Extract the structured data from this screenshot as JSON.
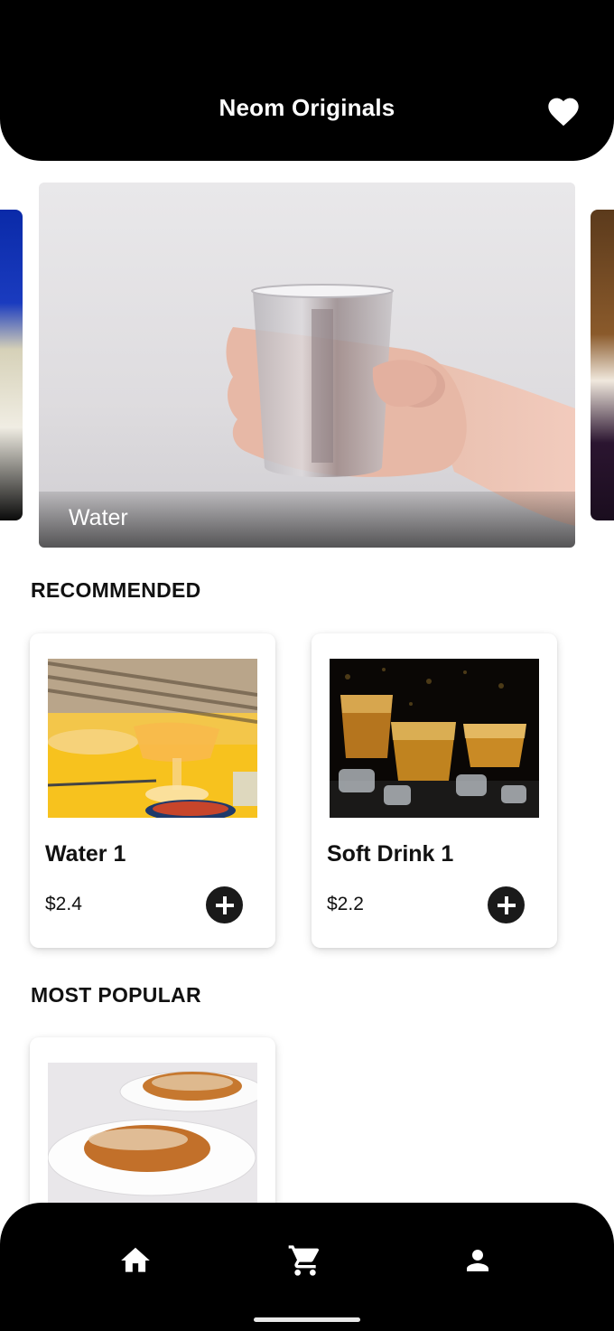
{
  "header": {
    "title": "Neom Originals",
    "favorite_icon": "heart-icon"
  },
  "carousel": {
    "active_slide": {
      "caption": "Water"
    }
  },
  "sections": {
    "recommended_title": "RECOMMENDED",
    "most_popular_title": "MOST POPULAR"
  },
  "recommended": [
    {
      "name": "Water 1",
      "price": "$2.4"
    },
    {
      "name": "Soft Drink 1",
      "price": "$2.2"
    }
  ],
  "most_popular": [
    {
      "image": "croissants"
    }
  ],
  "bottom_nav": {
    "items": [
      "home-icon",
      "cart-icon",
      "profile-icon"
    ]
  },
  "colors": {
    "header_bg": "#000000",
    "nav_bg": "#000000",
    "add_button": "#1a1a1a",
    "page_bg": "#ffffff"
  }
}
